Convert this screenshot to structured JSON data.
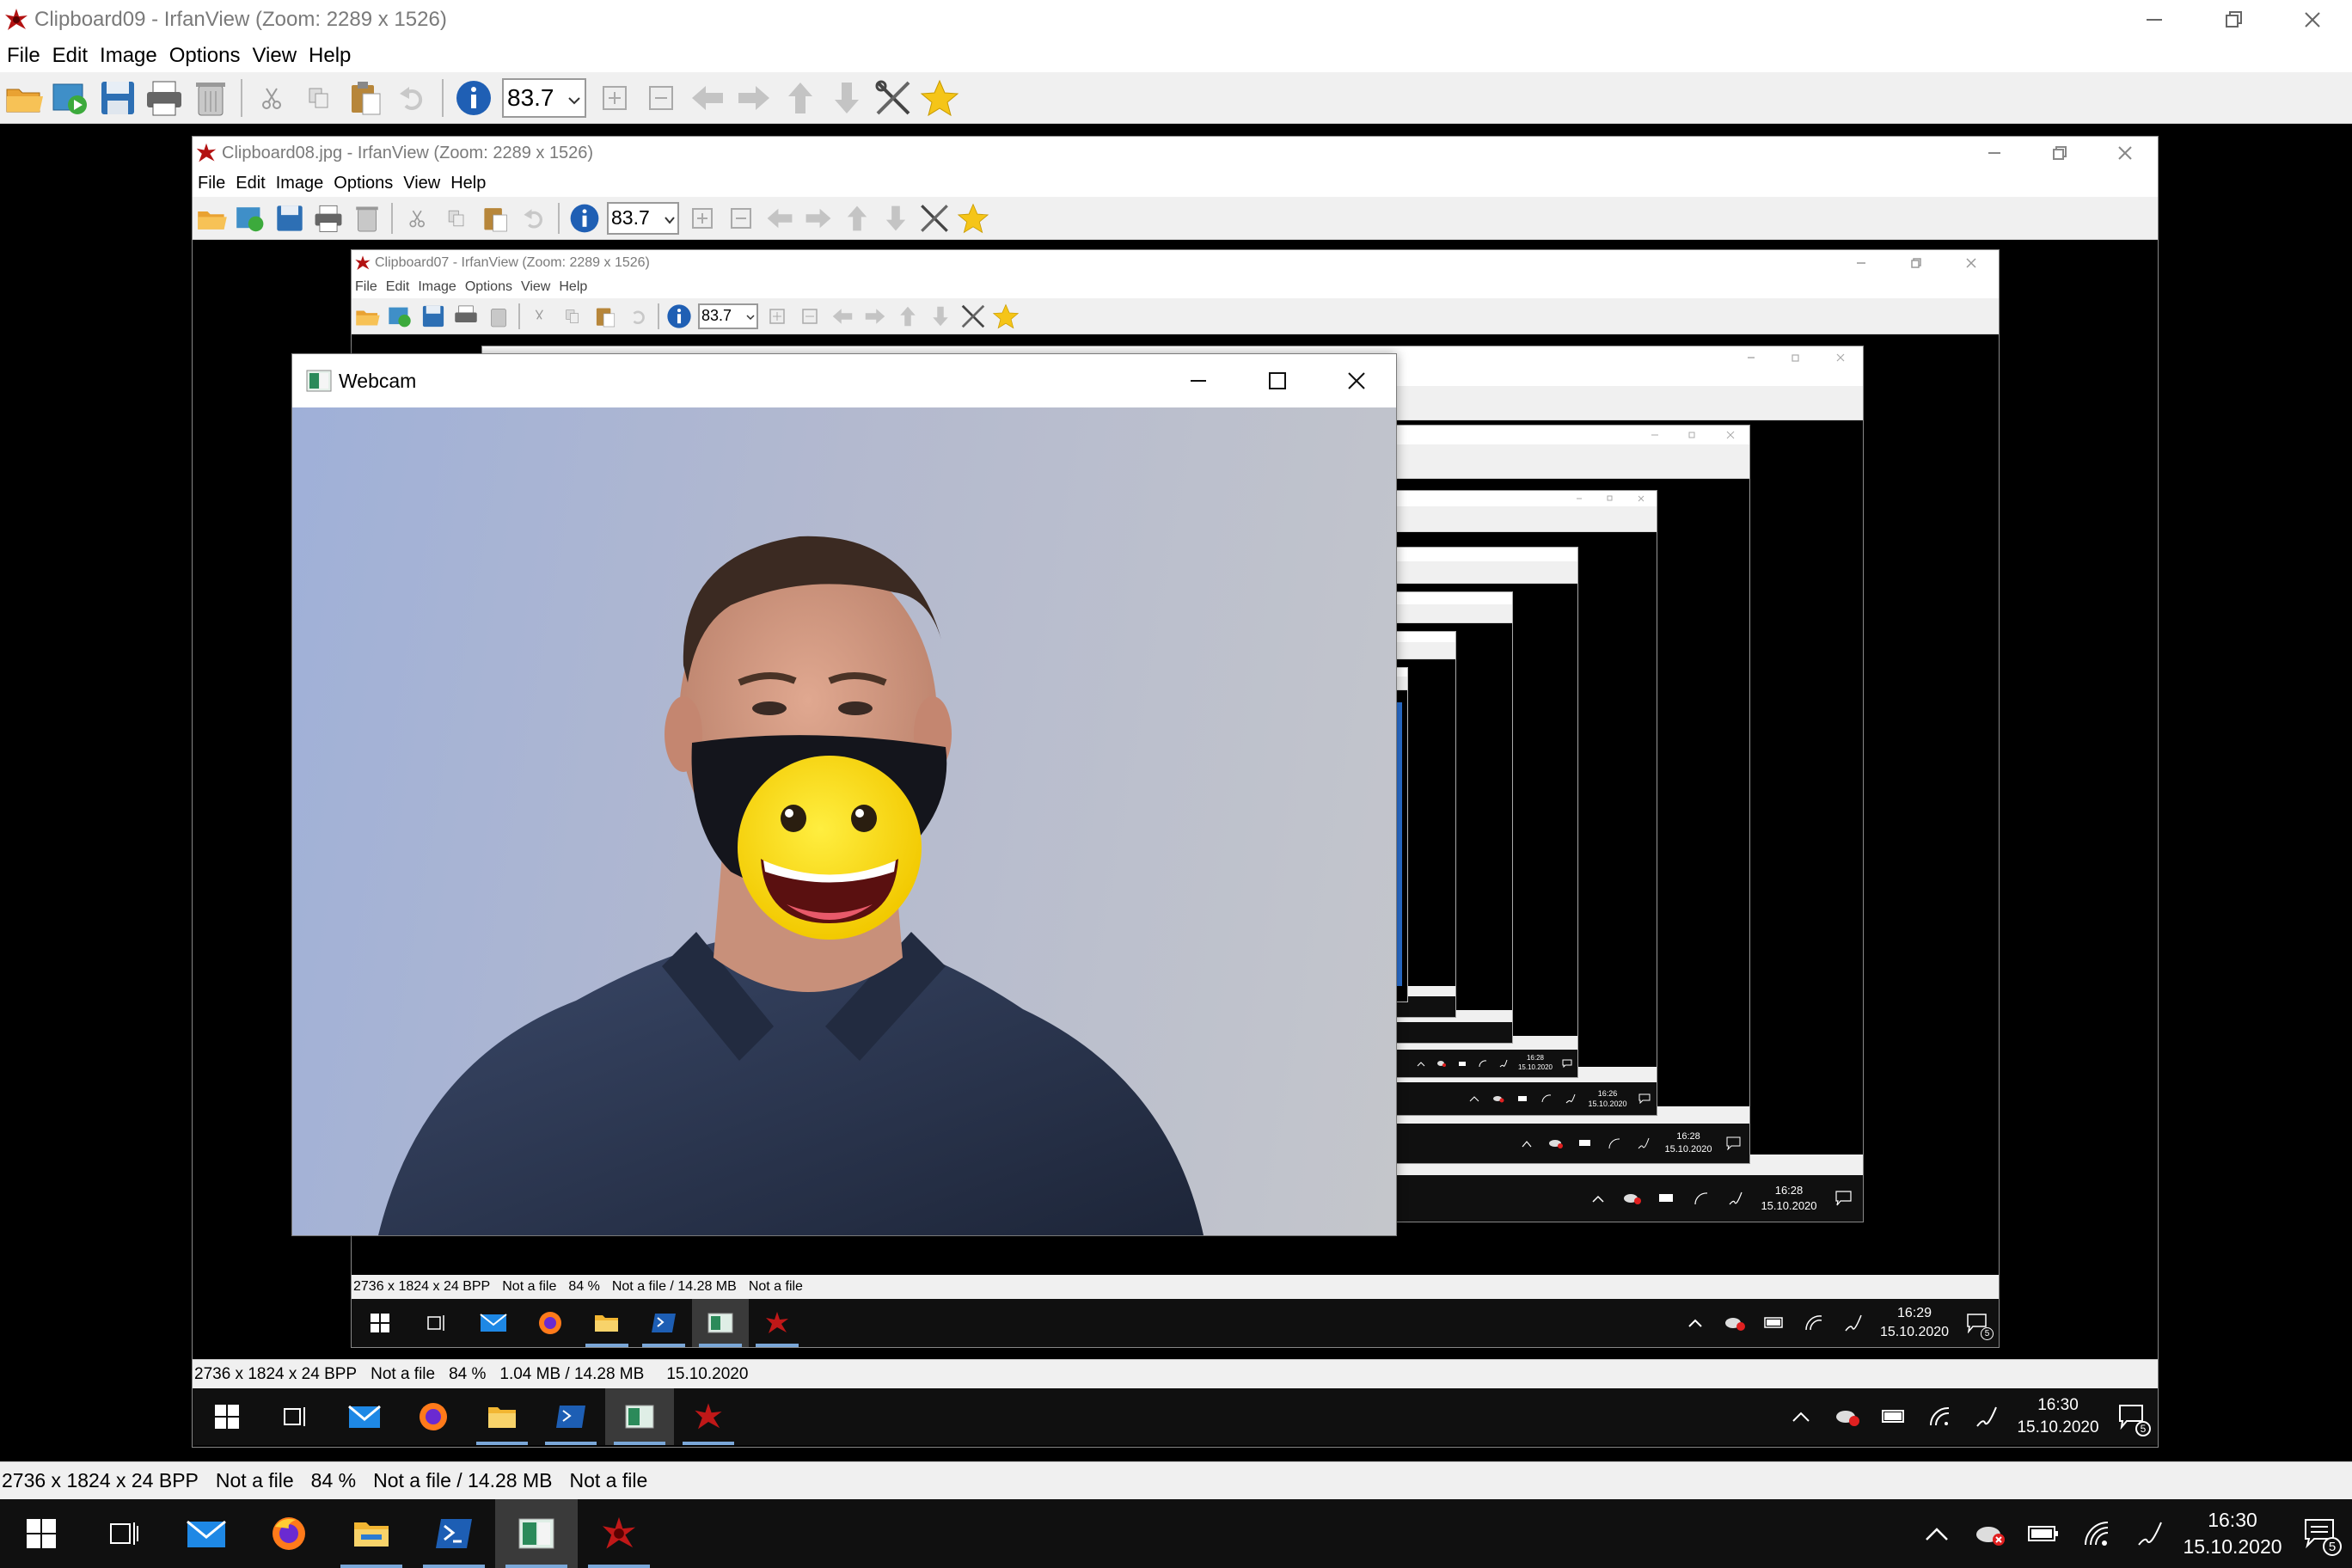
{
  "outer": {
    "title": "Clipboard09 - IrfanView (Zoom: 2289 x 1526)",
    "menu": [
      "File",
      "Edit",
      "Image",
      "Options",
      "View",
      "Help"
    ],
    "zoom_value": "83.7",
    "status": [
      "2736 x 1824 x 24 BPP",
      "Not a file",
      "84 %",
      "Not a file / 14.28 MB",
      "Not a file"
    ],
    "clock_time": "16:30",
    "clock_date": "15.10.2020",
    "notif_count": "5"
  },
  "level1": {
    "title": "Clipboard08.jpg - IrfanView (Zoom: 2289 x 1526)",
    "menu": [
      "File",
      "Edit",
      "Image",
      "Options",
      "View",
      "Help"
    ],
    "zoom_value": "83.7",
    "status": [
      "2736 x 1824 x 24 BPP",
      "Not a file",
      "84 %",
      "1.04 MB / 14.28 MB",
      "15.10.2020"
    ],
    "clock_time": "16:30",
    "clock_date": "15.10.2020",
    "notif_count": "5"
  },
  "level2": {
    "title": "Clipboard07 - IrfanView (Zoom: 2289 x 1526)",
    "menu": [
      "File",
      "Edit",
      "Image",
      "Options",
      "View",
      "Help"
    ],
    "zoom_value": "83.7",
    "status": [
      "2736 x 1824 x 24 BPP",
      "Not a file",
      "84 %",
      "Not a file / 14.28 MB",
      "Not a file"
    ],
    "clock_time": "16:29",
    "clock_date": "15.10.2020",
    "notif_count": "5"
  },
  "level3": {
    "clock_time": "16:28",
    "clock_date": "15.10.2020"
  },
  "level4": {
    "clock_time": "16:28",
    "clock_date": "15.10.2020"
  },
  "level5": {
    "clock_time": "16:26",
    "clock_date": "15.10.2020"
  },
  "level6": {
    "clock_time": "16:28",
    "clock_date": "15.10.2020"
  },
  "webcam": {
    "title": "Webcam"
  },
  "colors": {
    "taskbar": "#101010",
    "accent_underline": "#7aa7d8",
    "toolbar_bg": "#f0f0f0",
    "window_title_text": "#7a7a7a",
    "webcam_bg": "#aab1c8"
  }
}
